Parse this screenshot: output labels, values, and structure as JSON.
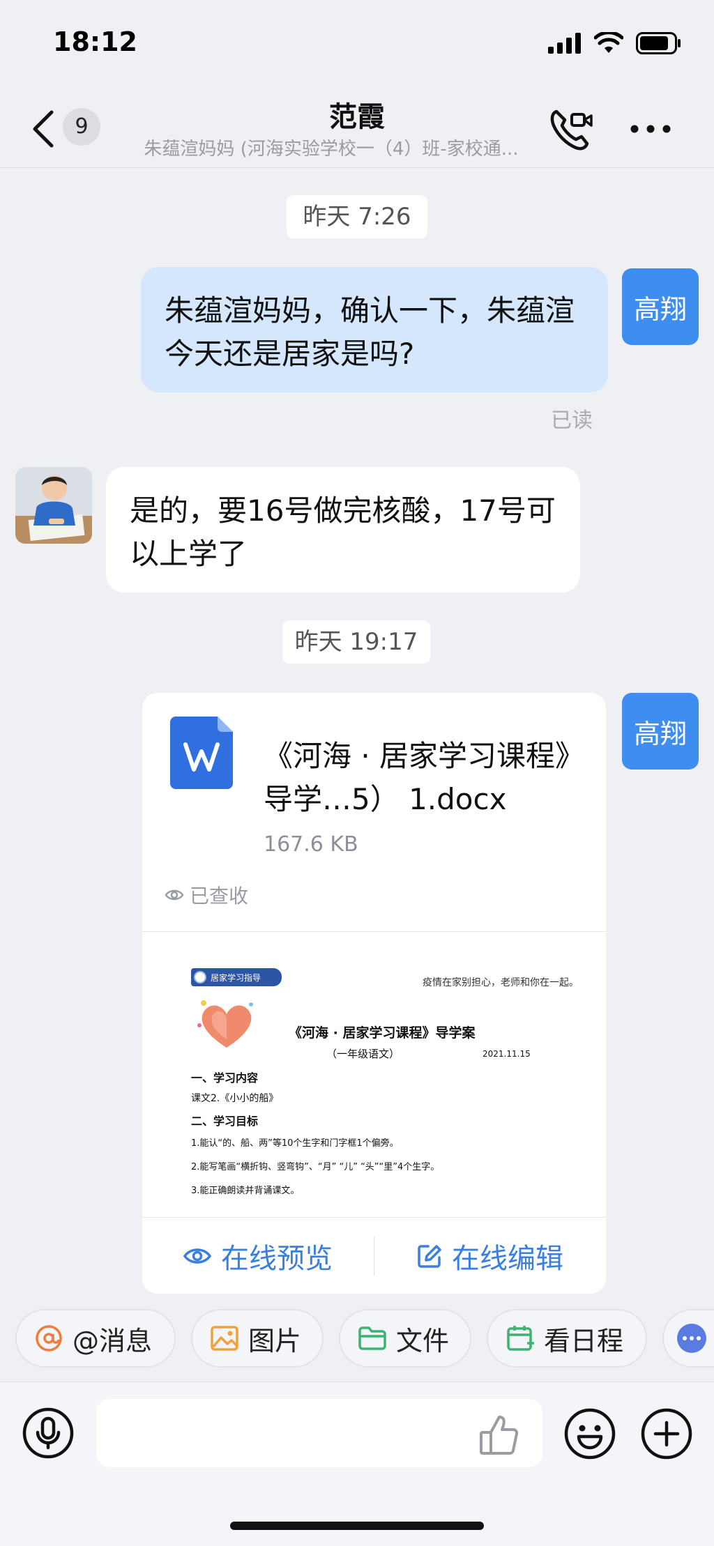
{
  "status_bar": {
    "time": "18:12"
  },
  "nav": {
    "unread_count": "9",
    "title": "范霞",
    "subtitle": "朱蕴渲妈妈 (河海实验学校一（4）班-家校通..."
  },
  "messages": {
    "time1": "昨天 7:26",
    "msg1_text": "朱蕴渲妈妈，确认一下，朱蕴渲今天还是居家是吗?",
    "msg1_sender": "高翔",
    "msg1_status": "已读",
    "msg2_text": "是的，要16号做完核酸，17号可以上学了",
    "time2": "昨天 19:17",
    "file_sender": "高翔",
    "file": {
      "name": "《河海 · 居家学习课程》导学…5） 1.docx",
      "size": "167.6 KB",
      "status": "已查收",
      "preview": {
        "banner": "居家学习指导",
        "tagline": "疫情在家别担心，老师和你在一起。",
        "title": "《河海 · 居家学习课程》导学案",
        "subtitle": "（一年级语文）",
        "date": "2021.11.15",
        "section1": "一、学习内容",
        "line1": "课文2.《小小的船》",
        "section2": "二、学习目标",
        "line2": "1.能认“的、船、两”等10个生字和门字框1个偏旁。",
        "line3": "2.能写笔画“横折钩、竖弯钩”、“月” “儿” “头”“里”4个生字。",
        "line4": "3.能正确朗读并背诵课文。"
      },
      "action_preview": "在线预览",
      "action_edit": "在线编辑"
    }
  },
  "quick_actions": [
    "@消息",
    "图片",
    "文件",
    "看日程"
  ],
  "colors": {
    "accent": "#3b7fde",
    "my_bubble": "#d4e7fc",
    "background": "#eff0f4",
    "avatar": "#3d8ef0"
  }
}
